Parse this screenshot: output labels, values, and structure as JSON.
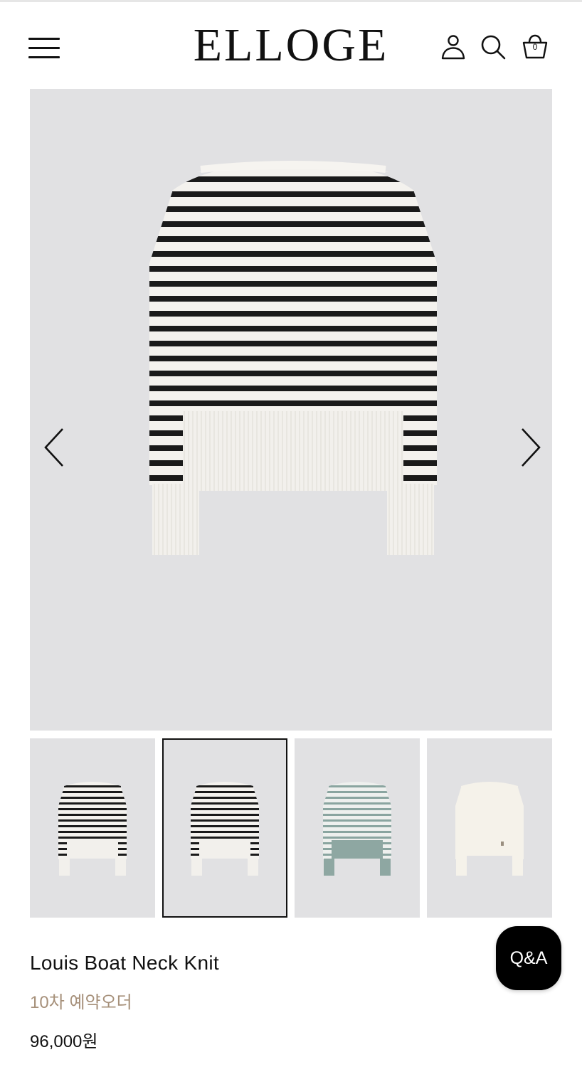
{
  "header": {
    "logo": "ELLOGE",
    "cart_count": "0",
    "icons": [
      "menu-icon",
      "user-icon",
      "search-icon",
      "cart-icon"
    ]
  },
  "gallery": {
    "selected_index": 1,
    "thumbnails": [
      {
        "variant": "black-white-stripe-front"
      },
      {
        "variant": "black-white-stripe-back"
      },
      {
        "variant": "green-white-stripe"
      },
      {
        "variant": "ivory-solid"
      }
    ]
  },
  "product": {
    "name": "Louis Boat Neck Knit",
    "preorder": "10차 예약오더",
    "price": "96,000원"
  },
  "floating": {
    "qa_label": "Q&A"
  },
  "colors": {
    "accent_preorder": "#a6907a",
    "image_bg": "#e1e1e3",
    "qa_bg": "#000000"
  }
}
